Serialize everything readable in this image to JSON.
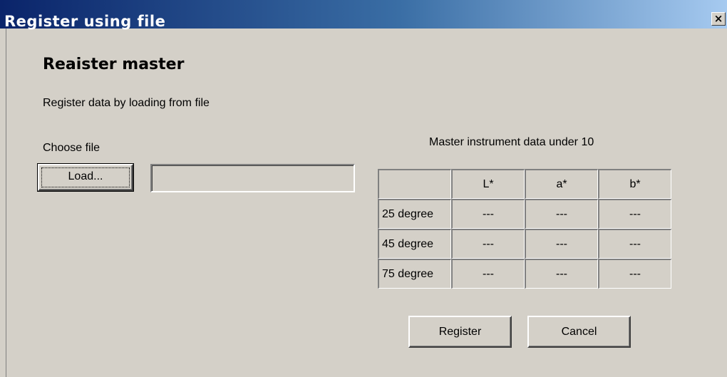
{
  "window": {
    "title": "Register using file",
    "close_label": "×"
  },
  "heading": "Reaister master",
  "description": "Register data by loading from file",
  "choose_file_label": "Choose file",
  "load_button": "Load...",
  "file_path_value": "",
  "table": {
    "caption": "Master instrument data under 10",
    "columns": [
      "",
      "L*",
      "a*",
      "b*"
    ],
    "rows": [
      {
        "label": "25 degree",
        "values": [
          "---",
          "---",
          "---"
        ]
      },
      {
        "label": "45 degree",
        "values": [
          "---",
          "---",
          "---"
        ]
      },
      {
        "label": "75 degree",
        "values": [
          "---",
          "---",
          "---"
        ]
      }
    ]
  },
  "register_button": "Register",
  "cancel_button": "Cancel"
}
